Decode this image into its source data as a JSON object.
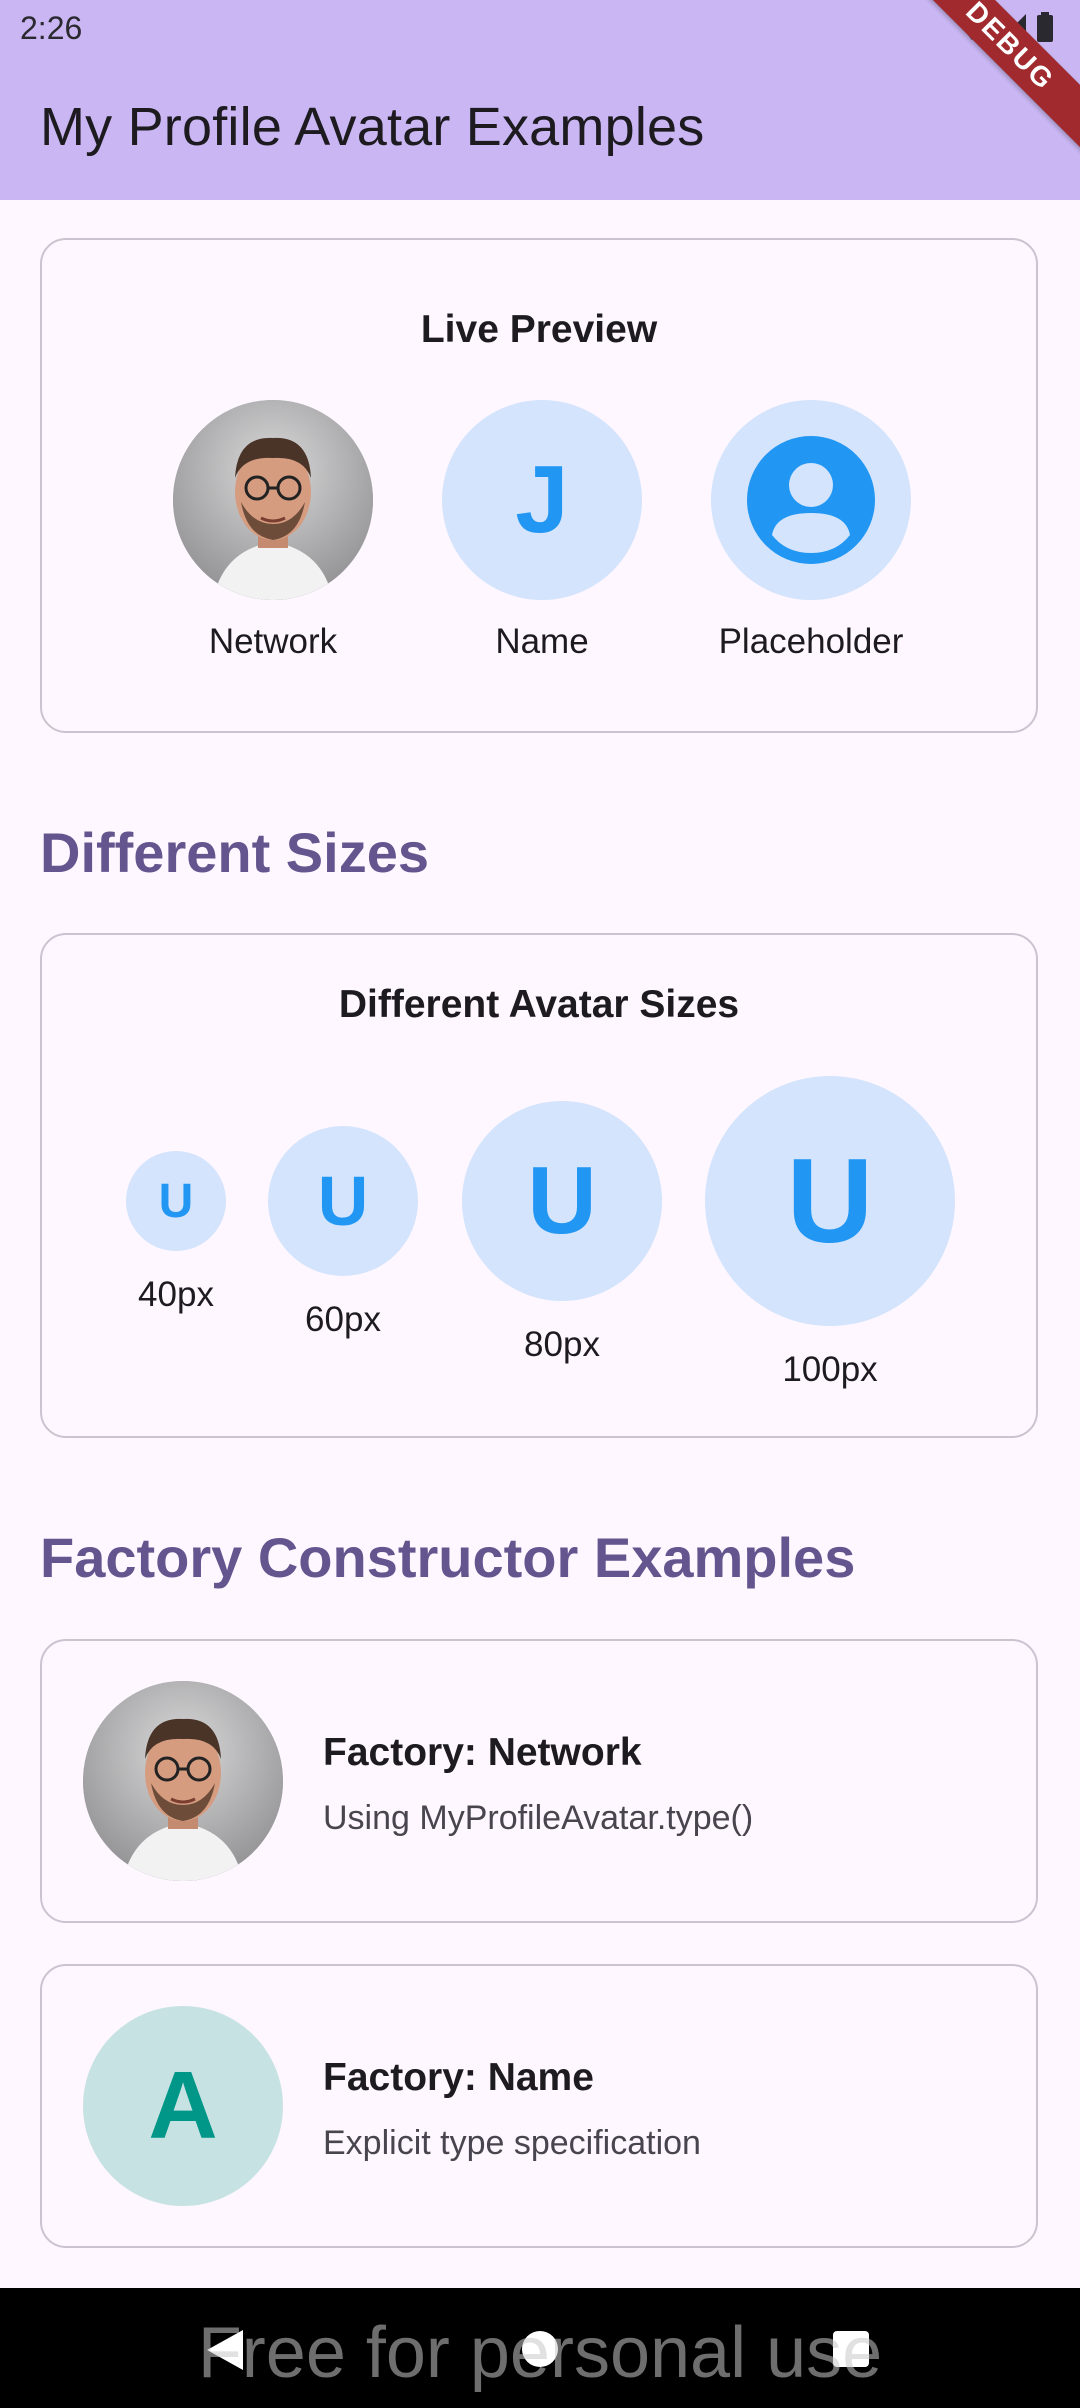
{
  "status_bar": {
    "time": "2:26"
  },
  "app_bar": {
    "title": "My Profile Avatar Examples",
    "debug_label": "DEBUG"
  },
  "live_preview": {
    "title": "Live Preview",
    "items": [
      {
        "label": "Network",
        "initial": ""
      },
      {
        "label": "Name",
        "initial": "J"
      },
      {
        "label": "Placeholder",
        "initial": ""
      }
    ]
  },
  "sizes_section": {
    "heading": "Different Sizes",
    "card_title": "Different Avatar Sizes",
    "items": [
      {
        "initial": "U",
        "label": "40px"
      },
      {
        "initial": "U",
        "label": "60px"
      },
      {
        "initial": "U",
        "label": "80px"
      },
      {
        "initial": "U",
        "label": "100px"
      }
    ]
  },
  "factory_section": {
    "heading": "Factory Constructor Examples",
    "rows": [
      {
        "title": "Factory: Network",
        "subtitle": "Using MyProfileAvatar.type()",
        "initial": ""
      },
      {
        "title": "Factory: Name",
        "subtitle": "Explicit type specification",
        "initial": "A"
      }
    ]
  },
  "nav_bar": {
    "watermark": "Free for personal use"
  },
  "colors": {
    "app_bar": "#c9b6f2",
    "accent_heading": "#65558f",
    "avatar_blue_bg": "#d3e4fc",
    "avatar_blue_fg": "#2196f3",
    "avatar_teal_bg": "#c7e2e3",
    "avatar_teal_fg": "#009688"
  },
  "icons": [
    "wifi-icon",
    "cell-signal-icon",
    "battery-icon",
    "person-icon",
    "back-icon",
    "home-icon",
    "recents-icon"
  ]
}
